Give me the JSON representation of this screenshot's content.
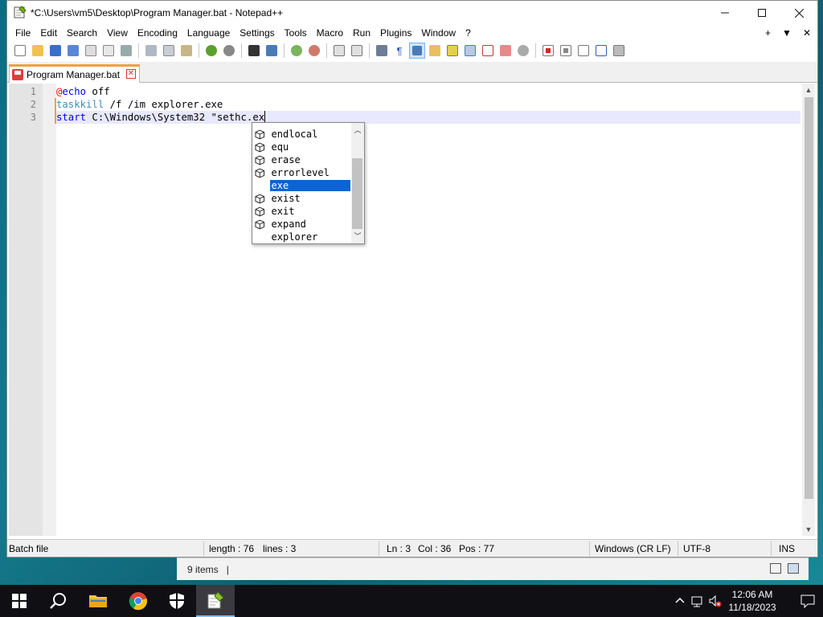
{
  "window": {
    "title": "*C:\\Users\\vm5\\Desktop\\Program Manager.bat - Notepad++",
    "minimize_glyph": "─",
    "maximize_glyph": "☐",
    "close_glyph": "✕"
  },
  "menu": {
    "items": [
      "File",
      "Edit",
      "Search",
      "View",
      "Encoding",
      "Language",
      "Settings",
      "Tools",
      "Macro",
      "Run",
      "Plugins",
      "Window",
      "?"
    ],
    "right_plus": "+",
    "right_down": "▼",
    "right_close": "✕"
  },
  "tab": {
    "label": "Program Manager.bat",
    "close_glyph": "✕"
  },
  "editor": {
    "line_numbers": [
      "1",
      "2",
      "3"
    ],
    "lines": [
      {
        "at": "@",
        "kw": "echo",
        "rest": " off"
      },
      {
        "kw": "taskkill",
        "rest": " /f /im explorer.exe"
      },
      {
        "kw": "start",
        "rest": " C:\\Windows\\System32 \"sethc.ex"
      }
    ]
  },
  "autocomplete": {
    "items": [
      {
        "text": "endlocal",
        "icon": "cube-icon"
      },
      {
        "text": "equ",
        "icon": "cube-icon"
      },
      {
        "text": "erase",
        "icon": "cube-icon"
      },
      {
        "text": "errorlevel",
        "icon": "cube-icon"
      },
      {
        "text": "exe",
        "icon": "none",
        "selected": true
      },
      {
        "text": "exist",
        "icon": "cube-icon"
      },
      {
        "text": "exit",
        "icon": "cube-icon"
      },
      {
        "text": "expand",
        "icon": "cube-icon"
      },
      {
        "text": "explorer",
        "icon": "none"
      }
    ],
    "selected_color": "#0a64d6"
  },
  "status": {
    "file_type": "Batch file",
    "length": "length : 76",
    "lines": "lines : 3",
    "ln": "Ln : 3",
    "col": "Col : 36",
    "pos": "Pos : 77",
    "eol": "Windows (CR LF)",
    "encoding": "UTF-8",
    "mode": "INS"
  },
  "explorer": {
    "items_count": "9 items",
    "divider": "|"
  },
  "taskbar": {
    "time": "12:06 AM",
    "date": "11/18/2023"
  },
  "colors": {
    "keyword": "#0000ff",
    "at_sign": "#e00000",
    "current_line": "#e8e8ff",
    "modified_marker": "#f0a040"
  }
}
